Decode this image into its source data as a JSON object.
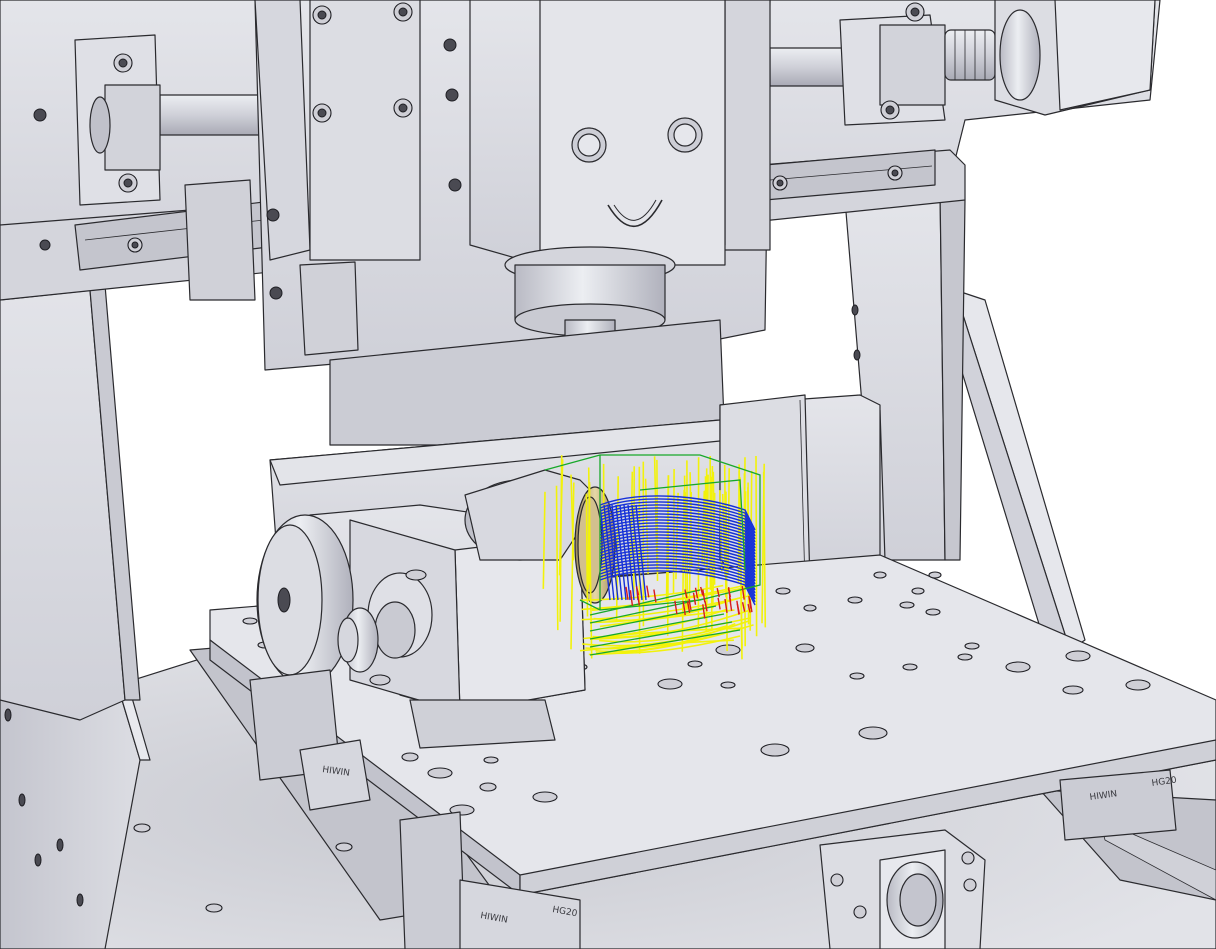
{
  "scene": {
    "labels": {
      "rail_brand_left": "HIWIN",
      "rail_brand_right": "HIWIN",
      "rail_brand_bottom": "HIWIN",
      "rail_model_right": "HG20",
      "rail_model_bottom": "HG20"
    },
    "colors": {
      "background": "#ffffff",
      "body": "#d7d8df",
      "body_light": "#e4e5ea",
      "body_shadow": "#b7b8c2",
      "edge": "#2a2a2e",
      "toolpath_yellow": "#f2f20a",
      "toolpath_blue": "#1530d8",
      "toolpath_green": "#17a82a",
      "toolpath_red": "#d81a1a",
      "brass": "#c9b27a",
      "tool": "#5a4a2a"
    }
  }
}
